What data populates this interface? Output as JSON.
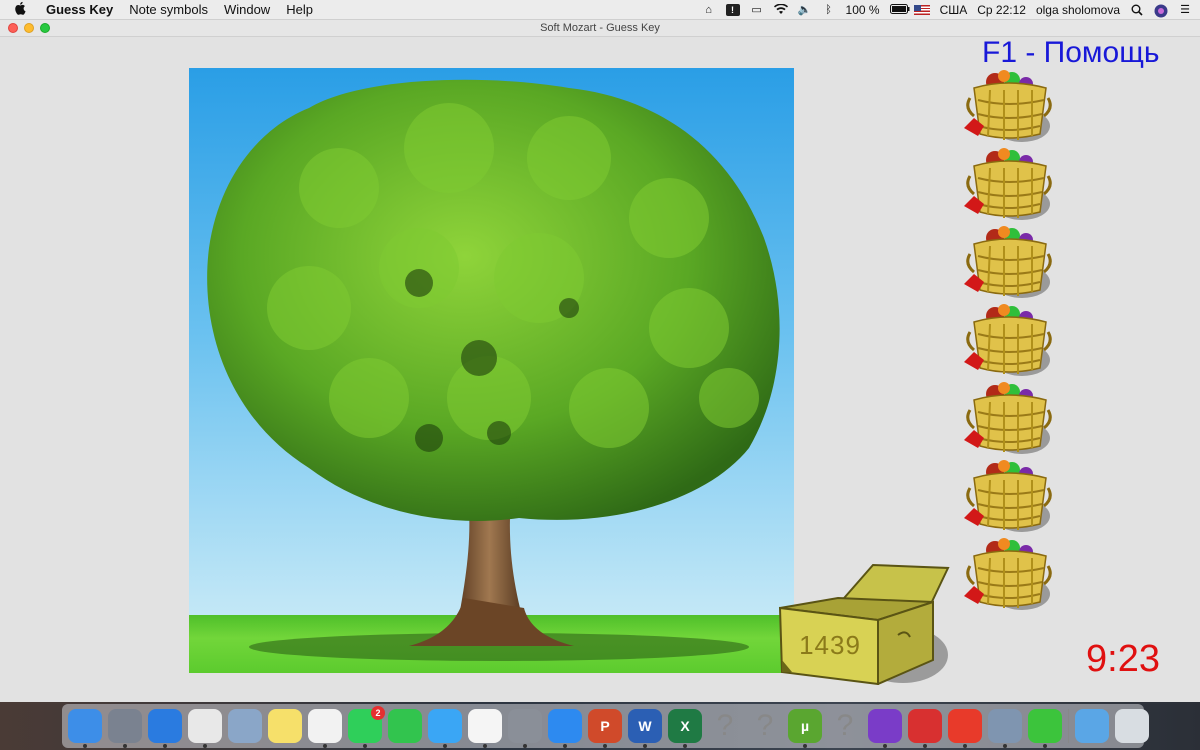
{
  "menubar": {
    "apple_icon": "apple-icon",
    "items": [
      "Guess Key",
      "Note symbols",
      "Window",
      "Help"
    ],
    "status": {
      "battery": "100 %",
      "input_source": "США",
      "clock": "Ср 22:12",
      "user": "olga sholomova"
    }
  },
  "window": {
    "title": "Soft Mozart - Guess Key"
  },
  "game": {
    "help_text": "F1 - Помощь",
    "score": "1439",
    "timer": "9:23",
    "baskets_count": 7,
    "colors": {
      "help": "#1818d8",
      "timer": "#e01010"
    }
  },
  "dock": {
    "items": [
      {
        "name": "finder",
        "label": "",
        "color": "#3d8ee8"
      },
      {
        "name": "launchpad",
        "label": "",
        "color": "#7a8290"
      },
      {
        "name": "safari",
        "label": "",
        "color": "#2a7be0"
      },
      {
        "name": "chrome",
        "label": "",
        "color": "#e8e8e8"
      },
      {
        "name": "preview",
        "label": "",
        "color": "#8aa6c8"
      },
      {
        "name": "notes",
        "label": "",
        "color": "#f6e06a"
      },
      {
        "name": "photos",
        "label": "",
        "color": "#f2f2f2"
      },
      {
        "name": "whatsapp",
        "label": "",
        "color": "#2fcf5a",
        "badge": "2"
      },
      {
        "name": "facetime",
        "label": "",
        "color": "#32c44e"
      },
      {
        "name": "messages",
        "label": "",
        "color": "#3aa6f5"
      },
      {
        "name": "itunes",
        "label": "",
        "color": "#f5f5f5"
      },
      {
        "name": "system-preferences",
        "label": "",
        "color": "#8a8f98"
      },
      {
        "name": "app-store",
        "label": "",
        "color": "#2d8af0"
      },
      {
        "name": "powerpoint",
        "label": "P",
        "color": "#d04a2a"
      },
      {
        "name": "word",
        "label": "W",
        "color": "#2b5fb4"
      },
      {
        "name": "excel",
        "label": "X",
        "color": "#1f7a44"
      },
      {
        "name": "unknown-app-1",
        "label": "?",
        "color": ""
      },
      {
        "name": "unknown-app-2",
        "label": "?",
        "color": ""
      },
      {
        "name": "utorrent",
        "label": "µ",
        "color": "#5aa630"
      },
      {
        "name": "unknown-app-3",
        "label": "?",
        "color": ""
      },
      {
        "name": "visual-studio",
        "label": "",
        "color": "#7a3cc8"
      },
      {
        "name": "parallels",
        "label": "",
        "color": "#d83030"
      },
      {
        "name": "anydesk",
        "label": "",
        "color": "#e83a2a"
      },
      {
        "name": "image-capture",
        "label": "",
        "color": "#7f95b0"
      },
      {
        "name": "soft-mozart",
        "label": "",
        "color": "#3cc43c"
      },
      {
        "name": "downloads-folder",
        "label": "",
        "color": "#5aa6e6"
      },
      {
        "name": "trash",
        "label": "",
        "color": "#d8dde2"
      }
    ]
  }
}
